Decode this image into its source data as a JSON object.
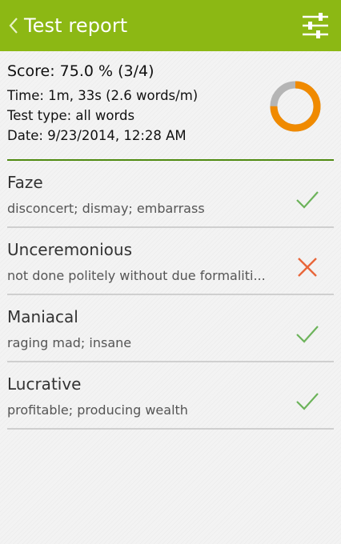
{
  "appbar": {
    "title": "Test report"
  },
  "summary": {
    "score": "Score: 75.0 % (3/4)",
    "score_fraction": 0.75,
    "time": "Time: 1m, 33s (2.6 words/m)",
    "type": "Test type: all words",
    "date": "Date: 9/23/2014, 12:28 AM"
  },
  "colors": {
    "accent": "#8cb814",
    "divider": "#4f8a10",
    "correct": "#6cb35a",
    "wrong": "#e8663a",
    "donut_fill": "#f08a00",
    "donut_rest": "#b5b5b5"
  },
  "icons": [
    "back-chevron-icon",
    "settings-sliders-icon",
    "check-icon",
    "cross-icon"
  ],
  "items": [
    {
      "word": "Faze",
      "definition": "disconcert; dismay; embarrass",
      "result": "correct"
    },
    {
      "word": "Unceremonious",
      "definition": "not done politely without due formaliti...",
      "result": "wrong"
    },
    {
      "word": "Maniacal",
      "definition": "raging mad; insane",
      "result": "correct"
    },
    {
      "word": "Lucrative",
      "definition": "profitable; producing wealth",
      "result": "correct"
    }
  ]
}
